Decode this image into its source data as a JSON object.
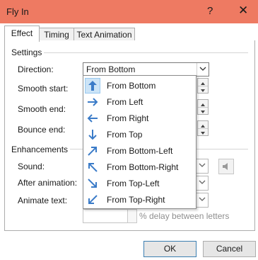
{
  "window": {
    "title": "Fly In",
    "help": "?",
    "close": "✕"
  },
  "tabs": [
    "Effect",
    "Timing",
    "Text Animation"
  ],
  "settings": {
    "title": "Settings",
    "direction": {
      "label": "Direction:",
      "value": "From Bottom"
    },
    "smooth_start": {
      "label": "Smooth start:"
    },
    "smooth_end": {
      "label": "Smooth end:"
    },
    "bounce_end": {
      "label": "Bounce end:"
    }
  },
  "enhancements": {
    "title": "Enhancements",
    "sound": {
      "label": "Sound:"
    },
    "after_animation": {
      "label": "After animation:"
    },
    "animate_text": {
      "label": "Animate text:"
    },
    "delay_label": "% delay between letters"
  },
  "direction_options": [
    {
      "label": "From Bottom",
      "arrow": "arrow-up-icon"
    },
    {
      "label": "From Left",
      "arrow": "arrow-right-icon"
    },
    {
      "label": "From Right",
      "arrow": "arrow-left-icon"
    },
    {
      "label": "From Top",
      "arrow": "arrow-down-icon"
    },
    {
      "label": "From Bottom-Left",
      "arrow": "arrow-up-right-icon"
    },
    {
      "label": "From Bottom-Right",
      "arrow": "arrow-up-left-icon"
    },
    {
      "label": "From Top-Left",
      "arrow": "arrow-down-right-icon"
    },
    {
      "label": "From Top-Right",
      "arrow": "arrow-down-left-icon"
    }
  ],
  "buttons": {
    "ok": "OK",
    "cancel": "Cancel"
  },
  "colors": {
    "titlebar": "#ee7a62",
    "arrow": "#3a7bc8",
    "selection": "#cce4f7"
  }
}
